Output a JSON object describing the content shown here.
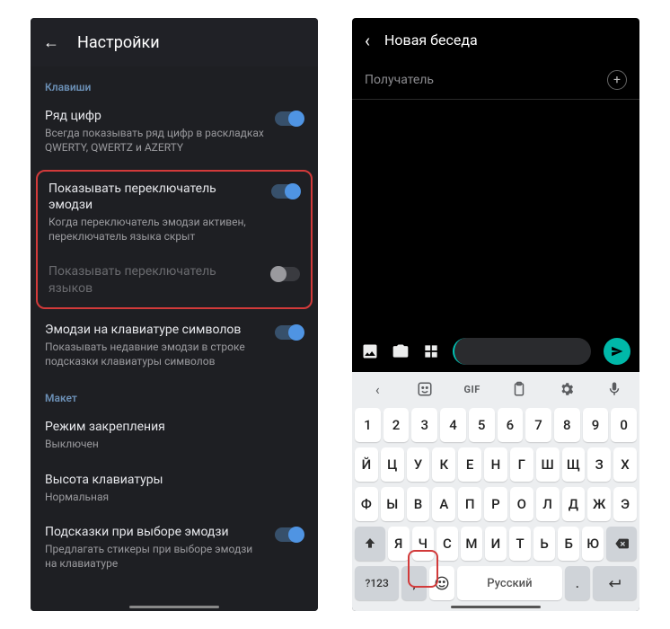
{
  "left": {
    "header": {
      "title": "Настройки"
    },
    "section_keys": "Клавиши",
    "s1": {
      "title": "Ряд цифр",
      "sub": "Всегда показывать ряд цифр в раскладках QWERTY, QWERTZ и AZERTY"
    },
    "s2": {
      "title": "Показывать переключатель эмодзи",
      "sub": "Когда переключатель эмодзи активен, переключатель языка скрыт"
    },
    "s3": {
      "title": "Показывать переключатель языков"
    },
    "s4": {
      "title": "Эмодзи на клавиатуре символов",
      "sub": "Показывать недавние эмодзи в строке подсказки клавиатуры символов"
    },
    "section_layout": "Макет",
    "s5": {
      "title": "Режим закрепления",
      "sub": "Выключен"
    },
    "s6": {
      "title": "Высота клавиатуры",
      "sub": "Нормальная"
    },
    "s7": {
      "title": "Подсказки при выборе эмодзи",
      "sub": "Предлагать стикеры при выборе эмодзи на клавиатуре"
    }
  },
  "right": {
    "header": {
      "title": "Новая беседа"
    },
    "recipient_label": "Получатель",
    "toolbar": {
      "gif": "GIF"
    },
    "keys": {
      "nums": [
        "1",
        "2",
        "3",
        "4",
        "5",
        "6",
        "7",
        "8",
        "9",
        "0"
      ],
      "r1": [
        "Й",
        "Ц",
        "У",
        "К",
        "Е",
        "Н",
        "Г",
        "Ш",
        "Щ",
        "З",
        "Х"
      ],
      "r2": [
        "Ф",
        "Ы",
        "В",
        "А",
        "П",
        "Р",
        "О",
        "Л",
        "Д",
        "Ж",
        "Э"
      ],
      "r3": [
        "Я",
        "Ч",
        "С",
        "М",
        "И",
        "Т",
        "Ь",
        "Б",
        "Ю"
      ],
      "bottom": {
        "sym": "?123",
        "comma": ",",
        "space": "Русский",
        "period": "."
      }
    }
  }
}
